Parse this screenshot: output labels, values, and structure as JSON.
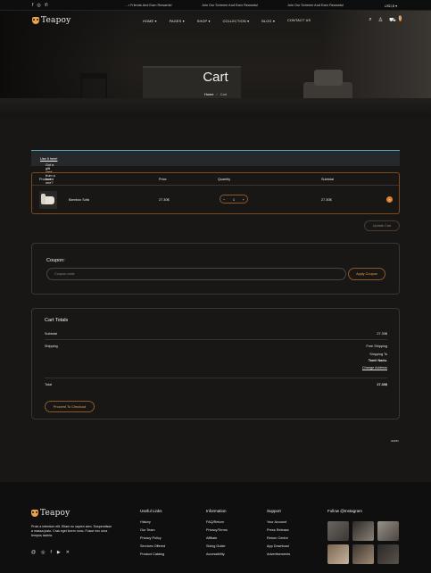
{
  "topbar": {
    "social_icons": [
      "facebook-icon",
      "instagram-icon",
      "whatsapp-icon"
    ],
    "marquee_1": "…r Friends And Earn Rewards!",
    "marquee_2": "Join Our Scheme And Earn Rewards!",
    "marquee_3": "Join Our Scheme And Earn Rewards!",
    "currency": "USD,$ ▾"
  },
  "brand": {
    "name": "Teapoy"
  },
  "nav": {
    "items": [
      "HOME ▾",
      "PAGES ▾",
      "SHOP ▾",
      "COLLECTION ▾",
      "BLOG ▾",
      "CONTACT US"
    ],
    "cart_count": "0"
  },
  "hero": {
    "title": "Cart",
    "crumb_home": "Home",
    "crumb_sep": "/",
    "crumb_current": "Cart"
  },
  "gift": {
    "text": "Got a gift card from a loved one?",
    "link": "Use it here!"
  },
  "cart_table": {
    "headers": {
      "product": "Product",
      "price": "Price",
      "quantity": "Quantity",
      "subtotal": "Subtotal"
    },
    "row": {
      "name": "Bamboo Sofa",
      "price": "27.30$",
      "qty": "1",
      "minus": "−",
      "plus": "+",
      "subtotal": "27.30$",
      "remove": "×"
    },
    "update_label": "Update Cart"
  },
  "coupon": {
    "title": "Coupon:",
    "placeholder": "Coupon code",
    "apply_label": "Apply Coupon"
  },
  "totals": {
    "title": "Cart Totals",
    "subtotal_label": "Subtotal",
    "subtotal_value": "27.30$",
    "shipping_label": "Shipping",
    "shipping_method": "Free Shipping",
    "shipping_to": "Shipping To",
    "shipping_region": "Tamil Nadu.",
    "change_address": "Change Address",
    "total_label": "Total",
    "total_value": "27.30$",
    "checkout_label": "Proceed To Checkout"
  },
  "gdpr": "GDPR",
  "footer": {
    "about": "Proin a interdum elit. Etiam eu sapien sem. Suspendisse a massa justo. Cras eget lorem nunc. Fusce nec urna tempus lacinia.",
    "social_icons": [
      "threads-icon",
      "instagram-icon",
      "facebook-icon",
      "youtube-icon",
      "x-icon"
    ],
    "useful_links": {
      "title": "Useful Links",
      "items": [
        "History",
        "Our Team",
        "Privacy Policy",
        "Services Offered",
        "Product Catalog"
      ]
    },
    "information": {
      "title": "Information",
      "items": [
        "FAQ/Return",
        "Privacy/Terms",
        "Affiliate",
        "Sizing Guide",
        "Accessibility"
      ]
    },
    "support": {
      "title": "Support",
      "items": [
        "Your Account",
        "Press Release",
        "Return Centre",
        "App Download",
        "Advertisements"
      ]
    },
    "instagram": {
      "title": "Follow @Instagram"
    }
  }
}
